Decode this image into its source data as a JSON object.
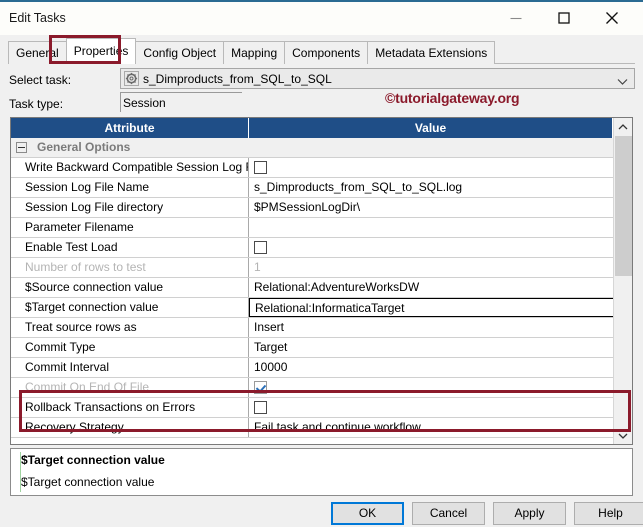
{
  "window": {
    "title": "Edit Tasks",
    "controls": {
      "minimize": "minimize-icon",
      "maximize": "maximize-icon",
      "close": "close-icon"
    }
  },
  "tabs": [
    {
      "label": "General",
      "active": false
    },
    {
      "label": "Properties",
      "active": true
    },
    {
      "label": "Config Object",
      "active": false
    },
    {
      "label": "Mapping",
      "active": false
    },
    {
      "label": "Components",
      "active": false
    },
    {
      "label": "Metadata Extensions",
      "active": false
    }
  ],
  "form": {
    "select_task_label": "Select task:",
    "select_task_value": "s_Dimproducts_from_SQL_to_SQL",
    "select_task_icon": "gear-icon",
    "task_type_label": "Task type:",
    "task_type_value": "Session"
  },
  "watermark": "©tutorialgateway.org",
  "grid": {
    "columns": [
      "Attribute",
      "Value"
    ],
    "rows": [
      {
        "attribute": "General Options",
        "value": "",
        "kind": "group",
        "expanded": true
      },
      {
        "attribute": "Write Backward Compatible Session Log File",
        "value": "",
        "kind": "checkbox",
        "checked": false
      },
      {
        "attribute": "Session Log File Name",
        "value": "s_Dimproducts_from_SQL_to_SQL.log",
        "kind": "text"
      },
      {
        "attribute": "Session Log File directory",
        "value": "$PMSessionLogDir\\",
        "kind": "text"
      },
      {
        "attribute": "Parameter Filename",
        "value": "",
        "kind": "text"
      },
      {
        "attribute": "Enable Test Load",
        "value": "",
        "kind": "checkbox",
        "checked": false
      },
      {
        "attribute": "Number of rows to test",
        "value": "1",
        "kind": "text",
        "disabled": true
      },
      {
        "attribute": "$Source connection value",
        "value": "Relational:AdventureWorksDW",
        "kind": "text"
      },
      {
        "attribute": "$Target connection value",
        "value": "Relational:InformaticaTarget",
        "kind": "dropdown",
        "selected": true
      },
      {
        "attribute": "Treat source rows as",
        "value": "Insert",
        "kind": "text"
      },
      {
        "attribute": "Commit Type",
        "value": "Target",
        "kind": "text"
      },
      {
        "attribute": "Commit Interval",
        "value": "10000",
        "kind": "text"
      },
      {
        "attribute": "Commit On End Of File",
        "value": "",
        "kind": "checkbox",
        "checked": true,
        "disabled": true
      },
      {
        "attribute": "Rollback Transactions on Errors",
        "value": "",
        "kind": "checkbox",
        "checked": false
      },
      {
        "attribute": "Recovery Strategy",
        "value": "Fail task and continue workflow",
        "kind": "text"
      }
    ]
  },
  "description": {
    "title": "$Target connection value",
    "body": "$Target connection value"
  },
  "footer": {
    "ok": "OK",
    "cancel": "Cancel",
    "apply": "Apply",
    "help": "Help"
  },
  "colors": {
    "header_blue": "#1f4e87",
    "highlight_red": "#8b1a2b",
    "accent_blue": "#0078d7",
    "titlebar_top": "#2b6b92"
  }
}
